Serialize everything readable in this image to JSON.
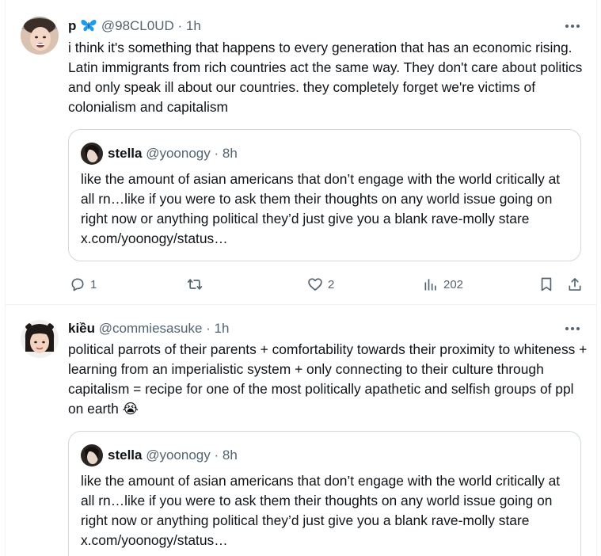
{
  "tweets": [
    {
      "display_name": "p",
      "badge_emoji": "🦋",
      "handle": "@98CL0UD",
      "separator": "·",
      "time": "1h",
      "text": "i think it's something that happens to every generation that has an economic rising. Latin immigrants from rich countries act the same way. They don't care about politics and only speak ill about our countries. they completely forget we're victims of colonialism and capitalism",
      "quote": {
        "display_name": "stella",
        "handle": "@yoonogy",
        "separator": "·",
        "time": "8h",
        "text": "like the amount of asian americans that don’t engage with the world critically at all rn…like if you were to ask them their thoughts on any world issue going on right now or anything political they’d just give you a blank rave-molly stare x.com/yoonogy/status…"
      },
      "actions": {
        "replies": "1",
        "likes": "2",
        "views": "202"
      }
    },
    {
      "display_name": "kiều",
      "handle": "@commiesasuke",
      "separator": "·",
      "time": "1h",
      "text": "political parrots of their parents + comfortability towards their proximity to whiteness + learning from an imperialistic system + only connecting to their culture through capitalism = recipe for one of the most politically apathetic and selfish groups of ppl on earth",
      "emoji": "😭",
      "quote": {
        "display_name": "stella",
        "handle": "@yoonogy",
        "separator": "·",
        "time": "8h",
        "text": "like the amount of asian americans that don’t engage with the world critically at all rn…like if you were to ask them their thoughts on any world issue going on right now or anything political they’d just give you a blank rave-molly stare x.com/yoonogy/status…"
      }
    }
  ],
  "colors": {
    "text": "#0f1419",
    "secondary": "#536471",
    "border": "#cfd9de",
    "divider": "#eff3f4",
    "butterfly": "#1d9bf0"
  }
}
